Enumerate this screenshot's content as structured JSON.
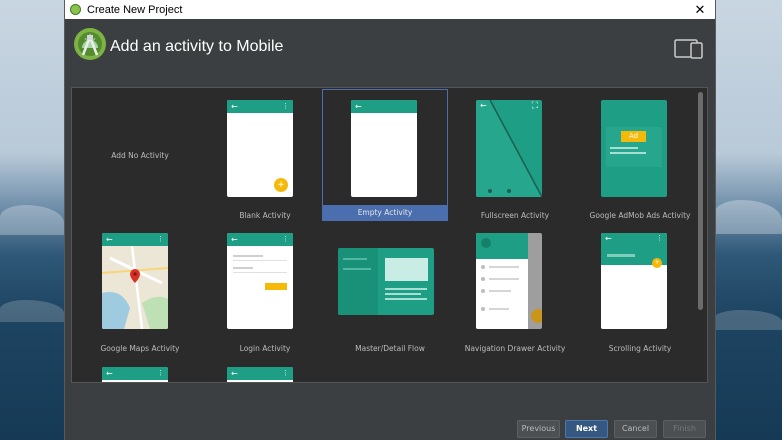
{
  "window": {
    "title": "Create New Project",
    "close_glyph": "✕"
  },
  "header": {
    "title": "Add an activity to Mobile",
    "logo_icon": "android-studio-logo",
    "device_icon": "phone-tablet-icon"
  },
  "activities": [
    {
      "label": "Add No Activity"
    },
    {
      "label": "Blank Activity"
    },
    {
      "label": "Empty Activity"
    },
    {
      "label": "Fullscreen Activity"
    },
    {
      "label": "Google AdMob Ads Activity"
    },
    {
      "label": "Google Maps Activity"
    },
    {
      "label": "Login Activity"
    },
    {
      "label": "Master/Detail Flow"
    },
    {
      "label": "Navigation Drawer Activity"
    },
    {
      "label": "Scrolling Activity"
    }
  ],
  "selected_activity": "Empty Activity",
  "admob_badge": "Ad",
  "footer": {
    "previous": "Previous",
    "next": "Next",
    "cancel": "Cancel",
    "finish": "Finish"
  },
  "colors": {
    "accent": "#1e9e84",
    "fab": "#f5b90a",
    "selection": "#4b6eaf"
  }
}
